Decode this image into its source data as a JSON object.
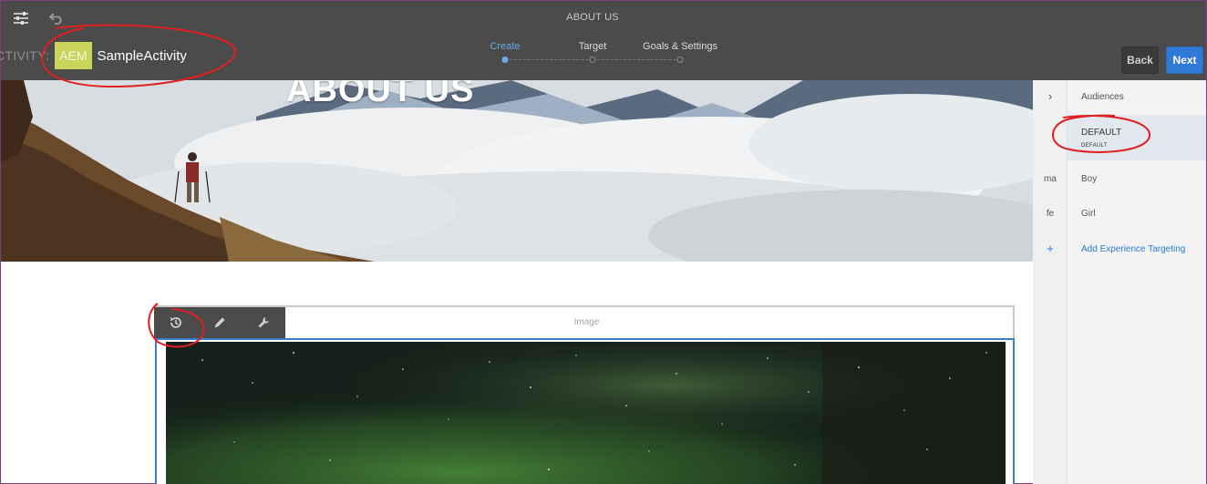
{
  "header": {
    "page_title": "ABOUT US",
    "activity_prefix": "CTIVITY:",
    "activity_badge": "AEM",
    "activity_name": "SampleActivity",
    "steps": [
      {
        "label": "Create",
        "active": true
      },
      {
        "label": "Target",
        "active": false
      },
      {
        "label": "Goals & Settings",
        "active": false
      }
    ],
    "back_label": "Back",
    "next_label": "Next",
    "icons": {
      "settings": "sliders-icon",
      "undo": "undo-icon"
    }
  },
  "hero": {
    "title": "ABOUT US"
  },
  "panel": {
    "audiences_label": "Audiences",
    "default_title": "DEFAULT",
    "default_subtitle": "DEFAULT",
    "experiences": [
      {
        "code": "ma",
        "label": "Boy"
      },
      {
        "code": "fe",
        "label": "Girl"
      }
    ],
    "add_plus": "+",
    "add_label": "Add Experience Targeting",
    "expand_glyph": "›"
  },
  "component": {
    "label": "Image",
    "toolbar_icons": [
      "history-icon",
      "pencil-icon",
      "wrench-icon"
    ]
  },
  "colors": {
    "header_bg": "#4b4b4b",
    "accent_blue": "#2f7ad6",
    "aem_badge": "#c8d45a",
    "annotation_red": "#e02020"
  }
}
